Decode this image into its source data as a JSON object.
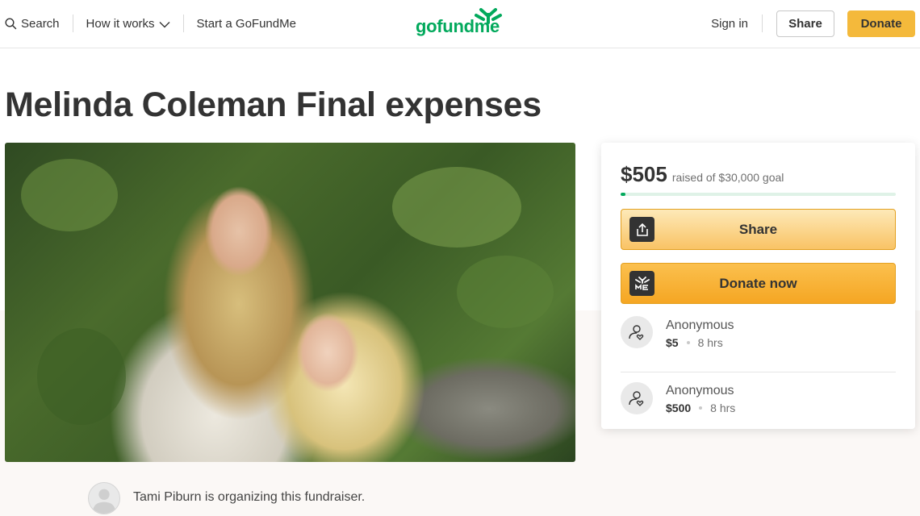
{
  "nav": {
    "search": "Search",
    "how_it_works": "How it works",
    "start": "Start a GoFundMe",
    "logo": "gofundme",
    "sign_in": "Sign in",
    "share": "Share",
    "donate": "Donate"
  },
  "campaign": {
    "title": "Melinda Coleman Final expenses",
    "raised": "$505",
    "goal_text": "raised of $30,000 goal",
    "progress_fraction": 0.0168,
    "share_label": "Share",
    "donate_label": "Donate now"
  },
  "donations": [
    {
      "name": "Anonymous",
      "amount": "$5",
      "time": "8 hrs"
    },
    {
      "name": "Anonymous",
      "amount": "$500",
      "time": "8 hrs"
    }
  ],
  "organizer": {
    "text": "Tami Piburn is organizing this fundraiser."
  },
  "colors": {
    "brand_green": "#02a95c",
    "donate_yellow": "#f4b93b"
  }
}
